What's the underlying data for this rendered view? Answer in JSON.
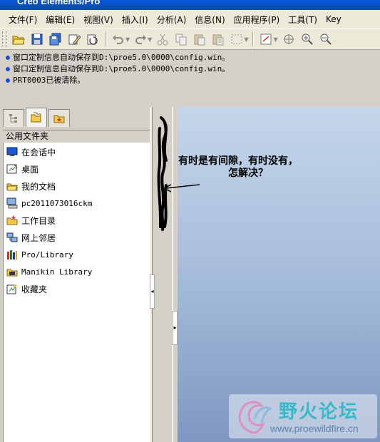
{
  "window": {
    "title": "Creo Elements/Pro"
  },
  "menubar": {
    "items": [
      "文件(F)",
      "编辑(E)",
      "视图(V)",
      "插入(I)",
      "分析(A)",
      "信息(N)",
      "应用程序(P)",
      "工具(T)",
      "Key"
    ]
  },
  "toolbar": {
    "icons": [
      "open-file-icon",
      "save-icon",
      "save-copy-icon",
      "erase-icon",
      "regenerate-icon",
      "undo-icon",
      "redo-icon",
      "cut-icon",
      "copy-icon",
      "paste-icon",
      "paste-special-icon",
      "select-box-icon",
      "model-tree-icon",
      "spin-center-icon",
      "zoom-in-icon",
      "zoom-out-icon"
    ]
  },
  "messages": [
    "窗口定制信息自动保存到D:\\proe5.0\\0000\\config.win。",
    "窗口定制信息自动保存到D:\\proe5.0\\0000\\config.win。",
    "PRT0003已被清除。"
  ],
  "navigator": {
    "tabs": [
      "model-tree-tab",
      "folder-browser-tab",
      "favorites-tab"
    ],
    "folder_header": "公用文件夹",
    "items": [
      {
        "label": "在会话中",
        "icon": "session-icon"
      },
      {
        "label": "桌面",
        "icon": "desktop-icon"
      },
      {
        "label": "我的文档",
        "icon": "my-documents-icon"
      },
      {
        "label": "pc2011073016ckm",
        "icon": "computer-icon"
      },
      {
        "label": "工作目录",
        "icon": "working-directory-icon"
      },
      {
        "label": "网上邻居",
        "icon": "network-icon"
      },
      {
        "label": "Pro/Library",
        "icon": "library-icon"
      },
      {
        "label": "Manikin Library",
        "icon": "manikin-library-icon"
      },
      {
        "label": "收藏夹",
        "icon": "favorites-icon"
      }
    ]
  },
  "annotation": {
    "line1": "有时是有间隙，有时没有，",
    "line2": "怎解决？"
  },
  "watermark": {
    "title": "野火论坛",
    "url": "www.proewildfire.cn"
  },
  "colors": {
    "titlebar": "#0a58d8",
    "graphics_top": "#c4d6ea",
    "graphics_bottom": "#7f98c2",
    "watermark_text": "#3ab8c8"
  }
}
